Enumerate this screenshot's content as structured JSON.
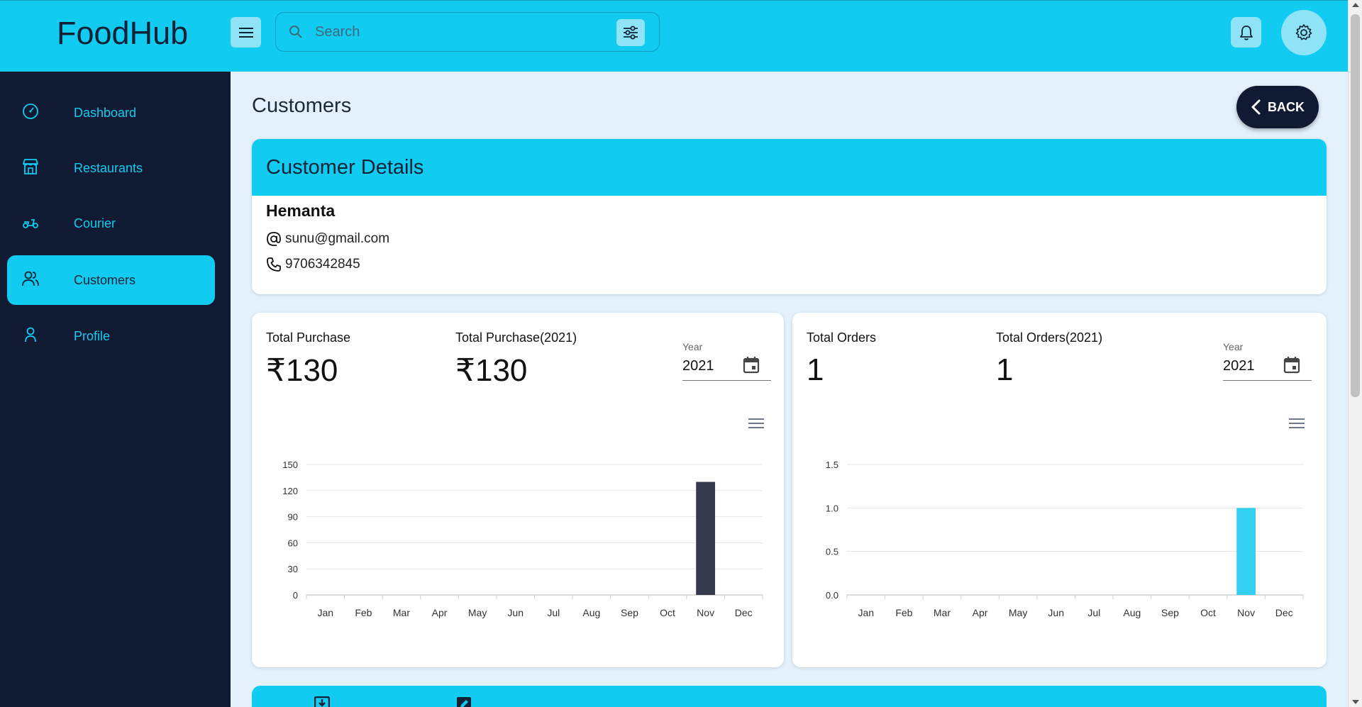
{
  "header": {
    "brand": "FoodHub",
    "search_placeholder": "Search"
  },
  "sidebar": {
    "items": [
      {
        "label": "Dashboard",
        "icon": "gauge-icon"
      },
      {
        "label": "Restaurants",
        "icon": "store-icon"
      },
      {
        "label": "Courier",
        "icon": "scooter-icon"
      },
      {
        "label": "Customers",
        "icon": "users-icon",
        "active": true
      },
      {
        "label": "Profile",
        "icon": "user-icon"
      }
    ]
  },
  "main": {
    "title": "Customers",
    "back_label": "BACK"
  },
  "customer": {
    "card_title": "Customer Details",
    "name": "Hemanta",
    "email": "sunu@gmail.com",
    "phone": "9706342845"
  },
  "purchase_card": {
    "total_label": "Total Purchase",
    "total_value": "₹130",
    "year_total_label": "Total Purchase(2021)",
    "year_total_value": "₹130",
    "year_field_label": "Year",
    "year_field_value": "2021"
  },
  "orders_card": {
    "total_label": "Total Orders",
    "total_value": "1",
    "year_total_label": "Total Orders(2021)",
    "year_total_value": "1",
    "year_field_label": "Year",
    "year_field_value": "2021"
  },
  "colors": {
    "accent": "#12cbf0",
    "sidebar": "#101b33",
    "purchase_bar": "#323a4c",
    "orders_bar": "#33d0f2"
  },
  "chart_data": [
    {
      "type": "bar",
      "categories": [
        "Jan",
        "Feb",
        "Mar",
        "Apr",
        "May",
        "Jun",
        "Jul",
        "Aug",
        "Sep",
        "Oct",
        "Nov",
        "Dec"
      ],
      "values": [
        0,
        0,
        0,
        0,
        0,
        0,
        0,
        0,
        0,
        0,
        130,
        0
      ],
      "yticks": [
        "0",
        "30",
        "60",
        "90",
        "120",
        "150"
      ],
      "ylim": [
        0,
        150
      ],
      "grid": true,
      "color": "#323a4c"
    },
    {
      "type": "bar",
      "categories": [
        "Jan",
        "Feb",
        "Mar",
        "Apr",
        "May",
        "Jun",
        "Jul",
        "Aug",
        "Sep",
        "Oct",
        "Nov",
        "Dec"
      ],
      "values": [
        0,
        0,
        0,
        0,
        0,
        0,
        0,
        0,
        0,
        0,
        1,
        0
      ],
      "yticks": [
        "0.0",
        "0.5",
        "1.0",
        "1.5"
      ],
      "ylim": [
        0,
        1.5
      ],
      "grid": true,
      "color": "#33d0f2"
    }
  ]
}
